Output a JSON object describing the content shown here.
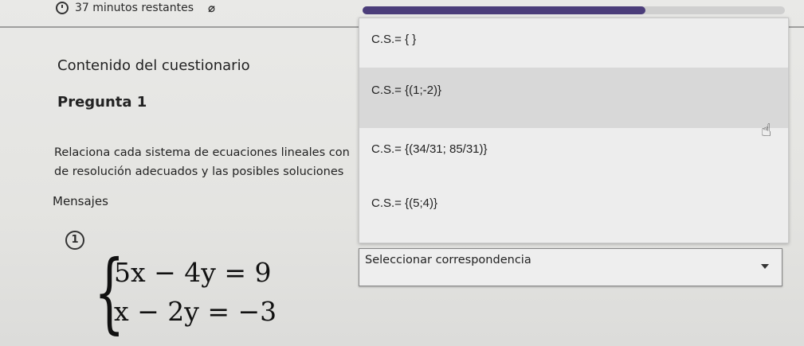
{
  "header": {
    "timer_text": "37 minutos restantes",
    "hide_icon_glyph": "⌀",
    "progress_fraction": 0.67
  },
  "navigation": {
    "title": "Contenido del cuestionario"
  },
  "question": {
    "title": "Pregunta 1",
    "instructions": "Relaciona cada sistema de ecuaciones lineales con de resolución adecuados y las posibles soluciones",
    "messages_label": "Mensajes",
    "item_number": "1",
    "brace_glyph": "{",
    "equation_1": "5x − 4y = 9",
    "equation_2": "x − 2y = −3"
  },
  "dropdown": {
    "options": [
      "C.S.= { }",
      "C.S.= {(1;-2)}",
      "C.S.= {(34/31; 85/31)}",
      "C.S.= {(5;4)}"
    ],
    "hovered_index": 1,
    "selected_label": "Seleccionar correspondencia",
    "cursor_glyph": "☝"
  },
  "colors": {
    "progress_fill": "#4b3d7a",
    "hover_row": "#d8d8d8"
  }
}
